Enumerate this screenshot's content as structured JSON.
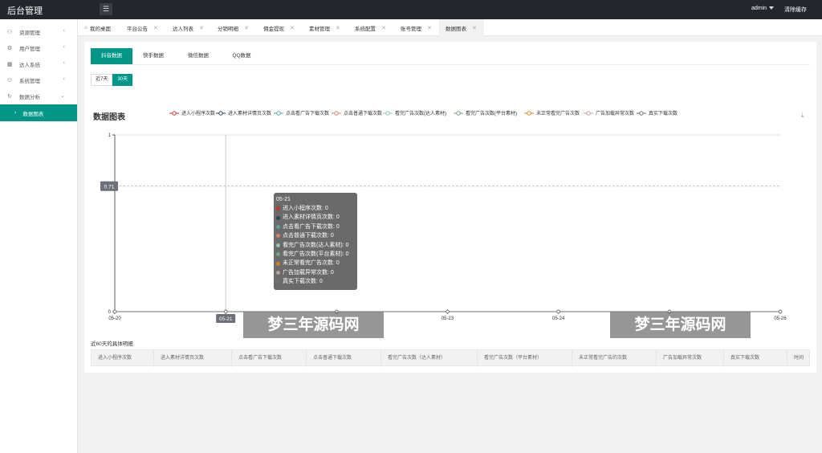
{
  "app": {
    "title": "后台管理",
    "user": "admin",
    "clear_cache": "清除缓存"
  },
  "sidebar": {
    "items": [
      {
        "label": "资源管理",
        "icon": "user-icon"
      },
      {
        "label": "用户管理",
        "icon": "settings-icon"
      },
      {
        "label": "达人系统",
        "icon": "grid-icon"
      },
      {
        "label": "系统管理",
        "icon": "user-icon"
      },
      {
        "label": "数据分析",
        "icon": "refresh-icon"
      }
    ],
    "sub_active": "数据图表"
  },
  "tabs": [
    {
      "label": "我的桌面"
    },
    {
      "label": "平台公告"
    },
    {
      "label": "达人列表"
    },
    {
      "label": "分销明细"
    },
    {
      "label": "佣金提现"
    },
    {
      "label": "素材管理"
    },
    {
      "label": "系统配置"
    },
    {
      "label": "账号管理"
    },
    {
      "label": "数据图表"
    }
  ],
  "subtabs": [
    "抖音数据",
    "快手数据",
    "微信数据",
    "QQ数据"
  ],
  "range": [
    "近7天",
    "30天"
  ],
  "chart_data": {
    "type": "line",
    "title": "数据图表",
    "x": [
      "05-20",
      "05-21",
      "05-22",
      "05-23",
      "05-24",
      "05-25",
      "05-26"
    ],
    "x_tick_labels": [
      "05-20",
      "05-21",
      "05-23",
      "05-24",
      "05-26"
    ],
    "ylim": [
      0,
      1
    ],
    "y_ticks": [
      "0",
      "1"
    ],
    "series": [
      {
        "name": "进入小程序次数",
        "color": "#c23531",
        "values": [
          0,
          0,
          0,
          0,
          0,
          0,
          0
        ]
      },
      {
        "name": "进入素材详情页次数",
        "color": "#2f4554",
        "values": [
          0,
          0,
          0,
          0,
          0,
          0,
          0
        ]
      },
      {
        "name": "点击看广告下载次数",
        "color": "#61a0a8",
        "values": [
          0,
          0,
          0,
          0,
          0,
          0,
          0
        ]
      },
      {
        "name": "点击普通下载次数",
        "color": "#d48265",
        "values": [
          0,
          0,
          0,
          0,
          0,
          0,
          0
        ]
      },
      {
        "name": "看完广告次数(达人素材)",
        "color": "#91c7ae",
        "values": [
          0,
          0,
          0,
          0,
          0,
          0,
          0
        ]
      },
      {
        "name": "看完广告次数(平台素材)",
        "color": "#749f83",
        "values": [
          0,
          0,
          0,
          0,
          0,
          0,
          0
        ]
      },
      {
        "name": "未正常看完广告次数",
        "color": "#ca8622",
        "values": [
          0,
          0,
          0,
          0,
          0,
          0,
          0
        ]
      },
      {
        "name": "广告加载异常次数",
        "color": "#bda29a",
        "values": [
          0,
          0,
          0,
          0,
          0,
          0,
          0
        ]
      },
      {
        "name": "真实下载次数",
        "color": "#6e7074",
        "values": [
          0,
          0,
          0,
          0,
          0,
          0,
          0
        ]
      }
    ],
    "legend_position": "top",
    "grid": true,
    "pointer": {
      "x_label": "05-21",
      "y_label": "0.71",
      "y_value": 0.71
    },
    "tooltip": {
      "title": "05-21",
      "rows": [
        "进入小程序次数: 0",
        "进入素材详情页次数: 0",
        "点击看广告下载次数: 0",
        "点击普通下载次数: 0",
        "看完广告次数(达人素材): 0",
        "看完广告次数(平台素材): 0",
        "未正常看完广告次数: 0",
        "广告加载异常次数: 0",
        "真实下载次数: 0"
      ]
    }
  },
  "watermark": "梦三年源码网",
  "detail": {
    "title": "近60天的具体明细",
    "columns": [
      "进入小程序次数",
      "进入素材详情页次数",
      "点击看广告下载次数",
      "点击普通下载次数",
      "看完广告次数（达人素材）",
      "看完广告次数（平台素材）",
      "未正常看完广告的次数",
      "广告加载异常次数",
      "真实下载次数",
      "时间"
    ]
  }
}
